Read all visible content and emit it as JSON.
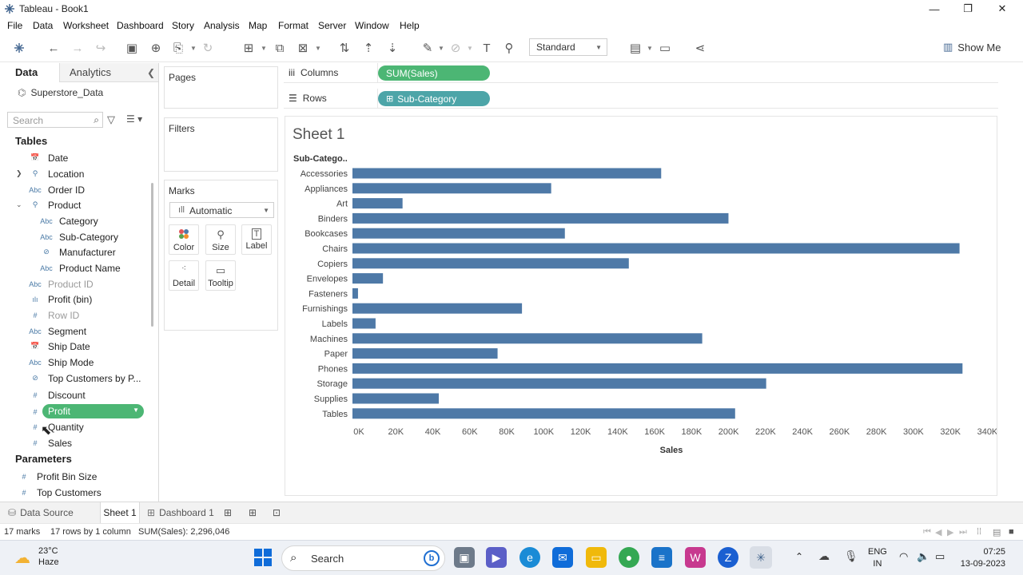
{
  "window": {
    "title": "Tableau - Book1",
    "controls": {
      "minimize": "—",
      "restore": "❐",
      "close": "✕"
    }
  },
  "menu": [
    "File",
    "Data",
    "Worksheet",
    "Dashboard",
    "Story",
    "Analysis",
    "Map",
    "Format",
    "Server",
    "Window",
    "Help"
  ],
  "toolbar": {
    "fit_select": "Standard",
    "show_me": "Show Me"
  },
  "data_pane": {
    "tab_data": "Data",
    "tab_analytics": "Analytics",
    "datasource": "Superstore_Data",
    "search_placeholder": "Search",
    "tables_header": "Tables",
    "fields": [
      {
        "label": "Date",
        "icon": "📅"
      },
      {
        "label": "Location",
        "icon": "⚲"
      },
      {
        "label": "Order ID",
        "icon": "Abc"
      },
      {
        "label": "Product",
        "icon": "⚲"
      },
      {
        "label": "Category",
        "icon": "Abc"
      },
      {
        "label": "Sub-Category",
        "icon": "Abc"
      },
      {
        "label": "Manufacturer",
        "icon": "⊘"
      },
      {
        "label": "Product Name",
        "icon": "Abc"
      },
      {
        "label": "Product ID",
        "icon": "Abc"
      },
      {
        "label": "Profit (bin)",
        "icon": "ılı"
      },
      {
        "label": "Row ID",
        "icon": "#"
      },
      {
        "label": "Segment",
        "icon": "Abc"
      },
      {
        "label": "Ship Date",
        "icon": "📅"
      },
      {
        "label": "Ship Mode",
        "icon": "Abc"
      },
      {
        "label": "Top Customers by P...",
        "icon": "⊘"
      },
      {
        "label": "Discount",
        "icon": "#"
      },
      {
        "label": "Profit",
        "icon": "#"
      },
      {
        "label": "Quantity",
        "icon": "#"
      },
      {
        "label": "Sales",
        "icon": "#"
      }
    ],
    "parameters_header": "Parameters",
    "parameters": [
      {
        "label": "Profit Bin Size",
        "icon": "#"
      },
      {
        "label": "Top Customers",
        "icon": "#"
      }
    ]
  },
  "cards": {
    "pages": "Pages",
    "filters": "Filters",
    "marks": "Marks",
    "mark_type": "Automatic",
    "buttons": [
      "Color",
      "Size",
      "Label",
      "Detail",
      "Tooltip"
    ]
  },
  "shelves": {
    "columns_label": "Columns",
    "rows_label": "Rows",
    "columns_pill": "SUM(Sales)",
    "rows_pill": "Sub-Category"
  },
  "sheet": {
    "title": "Sheet 1"
  },
  "chart_data": {
    "type": "bar",
    "orientation": "horizontal",
    "row_header": "Sub-Catego..",
    "xlabel": "Sales",
    "xlim": [
      0,
      345000
    ],
    "ticks": [
      0,
      20000,
      40000,
      60000,
      80000,
      100000,
      120000,
      140000,
      160000,
      180000,
      200000,
      220000,
      240000,
      260000,
      280000,
      300000,
      320000,
      340000
    ],
    "tick_labels": [
      "0K",
      "20K",
      "40K",
      "60K",
      "80K",
      "100K",
      "120K",
      "140K",
      "160K",
      "180K",
      "200K",
      "220K",
      "240K",
      "260K",
      "280K",
      "300K",
      "320K",
      "340K"
    ],
    "categories": [
      "Accessories",
      "Appliances",
      "Art",
      "Binders",
      "Bookcases",
      "Chairs",
      "Copiers",
      "Envelopes",
      "Fasteners",
      "Furnishings",
      "Labels",
      "Machines",
      "Paper",
      "Phones",
      "Storage",
      "Supplies",
      "Tables"
    ],
    "values": [
      167000,
      107500,
      27100,
      203400,
      114900,
      328400,
      149500,
      16500,
      3000,
      91700,
      12500,
      189200,
      78500,
      330000,
      223800,
      46700,
      207000
    ],
    "color": "#4e79a7",
    "grid": false
  },
  "tabs": {
    "data_source": "Data Source",
    "sheet1": "Sheet 1",
    "dashboard1": "Dashboard 1"
  },
  "status": {
    "marks": "17 marks",
    "rows_cols": "17 rows by 1 column",
    "sum": "SUM(Sales): 2,296,046"
  },
  "taskbar": {
    "temp": "23°C",
    "weather": "Haze",
    "search": "Search",
    "lang1": "ENG",
    "lang2": "IN",
    "time": "07:25",
    "date": "13-09-2023"
  }
}
